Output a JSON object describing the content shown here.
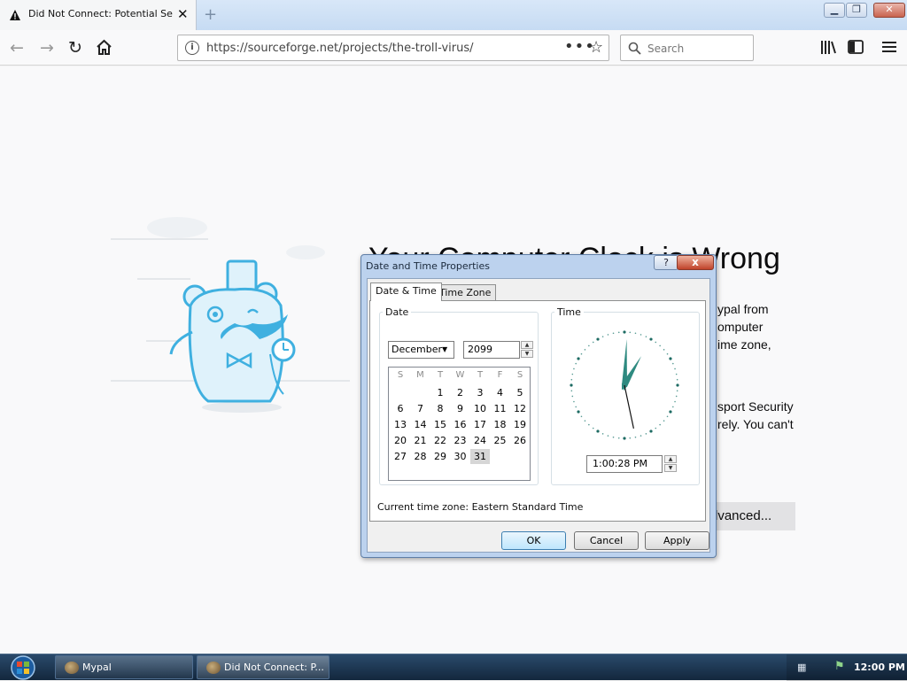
{
  "browser": {
    "tab_title": "Did Not Connect: Potential Secu",
    "new_tab_icon": "plus-icon",
    "url": "https://sourceforge.net/projects/the-troll-virus/",
    "search_placeholder": "Search",
    "window_buttons": [
      "minimize",
      "maximize",
      "close"
    ]
  },
  "page": {
    "heading": "Your Computer Clock is Wrong",
    "para1": [
      "ypal from",
      "omputer",
      "ime zone,"
    ],
    "para2": [
      "sport Security",
      "rely. You can't"
    ],
    "advanced_button": "dvanced..."
  },
  "dialog": {
    "title": "Date and Time Properties",
    "help_label": "?",
    "close_label": "x",
    "tabs": [
      "Date & Time",
      "Time Zone"
    ],
    "date_group_label": "Date",
    "time_group_label": "Time",
    "month": "December",
    "year": "2099",
    "weekdays": [
      "S",
      "M",
      "T",
      "W",
      "T",
      "F",
      "S"
    ],
    "calendar_rows": [
      [
        "",
        "",
        "1",
        "2",
        "3",
        "4",
        "5"
      ],
      [
        "6",
        "7",
        "8",
        "9",
        "10",
        "11",
        "12"
      ],
      [
        "13",
        "14",
        "15",
        "16",
        "17",
        "18",
        "19"
      ],
      [
        "20",
        "21",
        "22",
        "23",
        "24",
        "25",
        "26"
      ],
      [
        "27",
        "28",
        "29",
        "30",
        "31",
        "",
        ""
      ]
    ],
    "selected_day": "31",
    "time_value": "1:00:28 PM",
    "clock": {
      "hour": 1,
      "minute": 0,
      "second": 28
    },
    "timezone_label": "Current time zone:  Eastern Standard Time",
    "ok_label": "OK",
    "cancel_label": "Cancel",
    "apply_label": "Apply"
  },
  "taskbar": {
    "items": [
      "Mypal",
      "Did Not Connect: P..."
    ],
    "clock": "12:00 PM"
  },
  "colors": {
    "titlebar": "#c6dbf3",
    "dialog_frame": "#bcd2ee",
    "taskbar": "#1e3654",
    "mascot": "#3fb0e0",
    "clock_hand": "#2e8a80"
  }
}
